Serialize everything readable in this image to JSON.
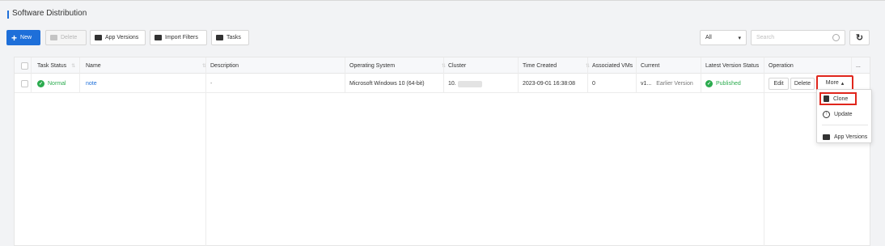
{
  "page": {
    "title": "Software Distribution"
  },
  "toolbar": {
    "new_label": "New",
    "delete_label": "Delete",
    "app_versions_label": "App Versions",
    "import_filters_label": "Import Filters",
    "tasks_label": "Tasks",
    "filter_value": "All",
    "search_placeholder": "Search"
  },
  "table": {
    "headers": {
      "task_status": "Task Status",
      "name": "Name",
      "description": "Description",
      "os": "Operating System",
      "cluster": "Cluster",
      "time_created": "Time Created",
      "associated_vms": "Associated VMs",
      "current": "Current",
      "latest_version_status": "Latest Version Status",
      "operation": "Operation",
      "more": "..."
    },
    "rows": [
      {
        "task_status": "Normal",
        "name": "note",
        "description": "-",
        "os": "Microsoft Windows 10 (64-bit)",
        "cluster": "10.",
        "time_created": "2023-09-01 16:38:08",
        "associated_vms": "0",
        "current": "v1...",
        "current_extra": "Earlier Version",
        "latest_version_status": "Published",
        "ops": {
          "edit": "Edit",
          "delete": "Delete",
          "more": "More"
        }
      }
    ]
  },
  "more_menu": {
    "items": [
      "Clone",
      "Update",
      "App Versions"
    ]
  },
  "colors": {
    "accent": "#1e6fd9",
    "success": "#2bab4e",
    "highlight": "#e0261c"
  }
}
